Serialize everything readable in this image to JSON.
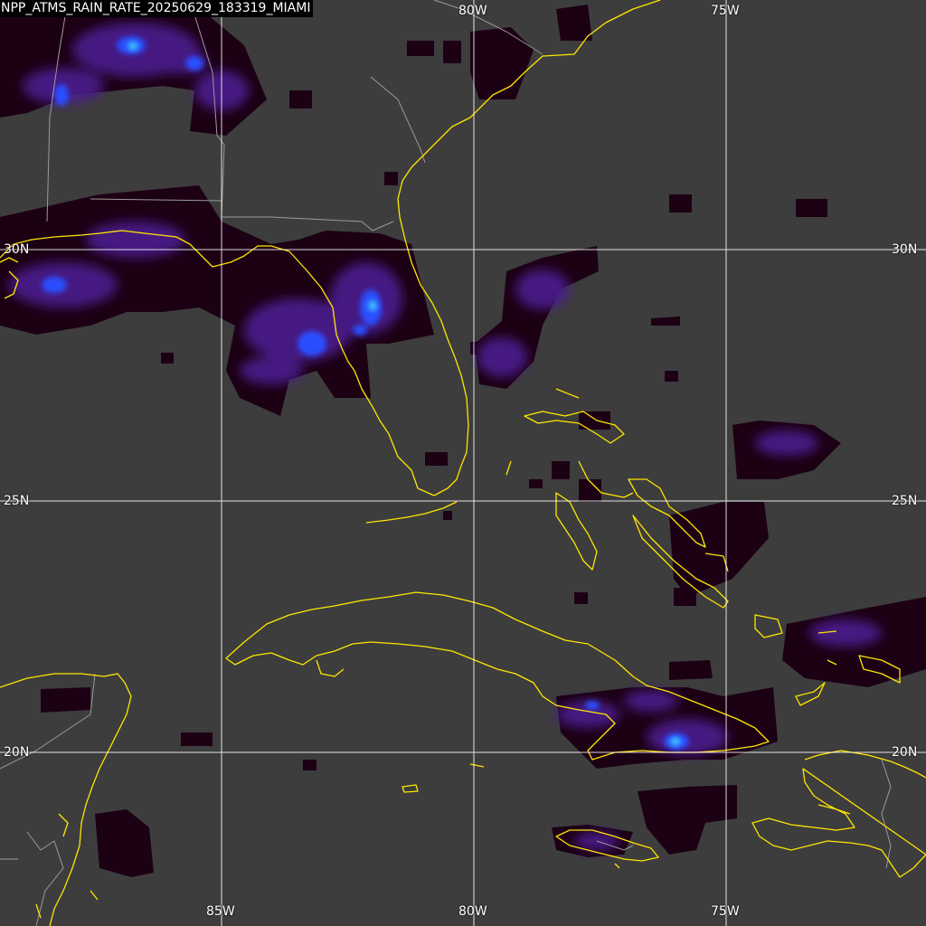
{
  "title": "NPP_ATMS_RAIN_RATE_20250629_183319_MIAMI",
  "colors": {
    "background": "#3d3d3d",
    "coastline": "#ffe600",
    "borders": "#9a9a9a",
    "gridlines": "#ffffff",
    "rain_low": "#1a0010",
    "rain_mid": "#4a1a8c",
    "rain_high": "#2a4dff",
    "rain_peak": "#40c8ff"
  },
  "gridlines": {
    "longitudes": [
      "85W",
      "80W",
      "75W"
    ],
    "latitudes": [
      "30N",
      "25N",
      "20N"
    ]
  },
  "labels": {
    "top_80w": "80W",
    "top_75w": "75W",
    "bottom_85w": "85W",
    "bottom_80w": "80W",
    "bottom_75w": "75W",
    "left_30n": "30N",
    "left_25n": "25N",
    "left_20n": "20N",
    "right_30n": "30N",
    "right_25n": "25N",
    "right_20n": "20N"
  }
}
